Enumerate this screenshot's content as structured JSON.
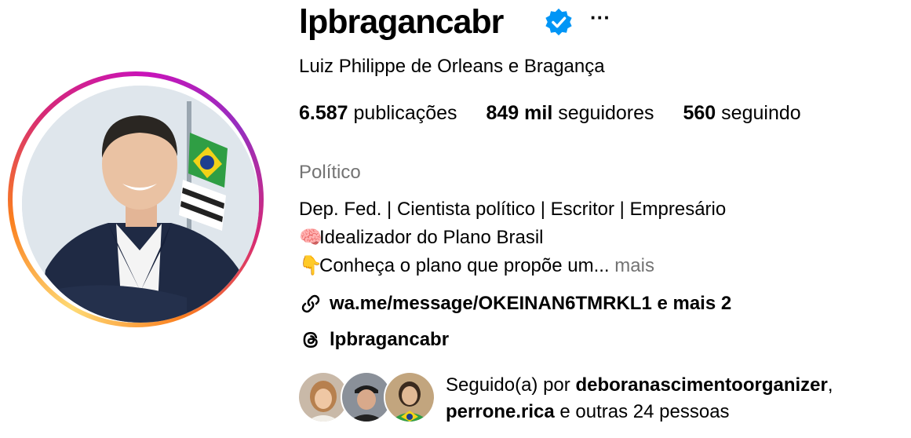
{
  "profile": {
    "username": "lpbragancabr",
    "full_name": "Luiz Philippe de Orleans e Bragança",
    "verified": true
  },
  "stats": {
    "posts_count": "6.587",
    "posts_label": "publicações",
    "followers_count": "849 mil",
    "followers_label": "seguidores",
    "following_count": "560",
    "following_label": "seguindo"
  },
  "bio": {
    "category": "Político",
    "line1": "Dep. Fed. | Cientista político | Escritor | Empresário",
    "line2_emoji": "🧠",
    "line2": "Idealizador do Plano Brasil",
    "line3_emoji": "👇",
    "line3": "Conheça o plano que propõe um...",
    "more": "mais"
  },
  "links": {
    "website": "wa.me/message/OKEINAN6TMRKL1 e mais 2",
    "threads": "lpbragancabr"
  },
  "followed_by": {
    "prefix": "Seguido(a) por",
    "user1": "deboranascimentoorganizer",
    "sep": ",",
    "user2": "perrone.rica",
    "suffix": "e outras 24 pessoas"
  },
  "icons": {
    "verified": "verified-badge-icon",
    "more": "more-options-icon",
    "link": "link-icon",
    "threads": "threads-icon"
  },
  "colors": {
    "verified_blue": "#0095f6",
    "muted_text": "#737373",
    "ring_start": "#feda75",
    "ring_end": "#c913b9"
  }
}
